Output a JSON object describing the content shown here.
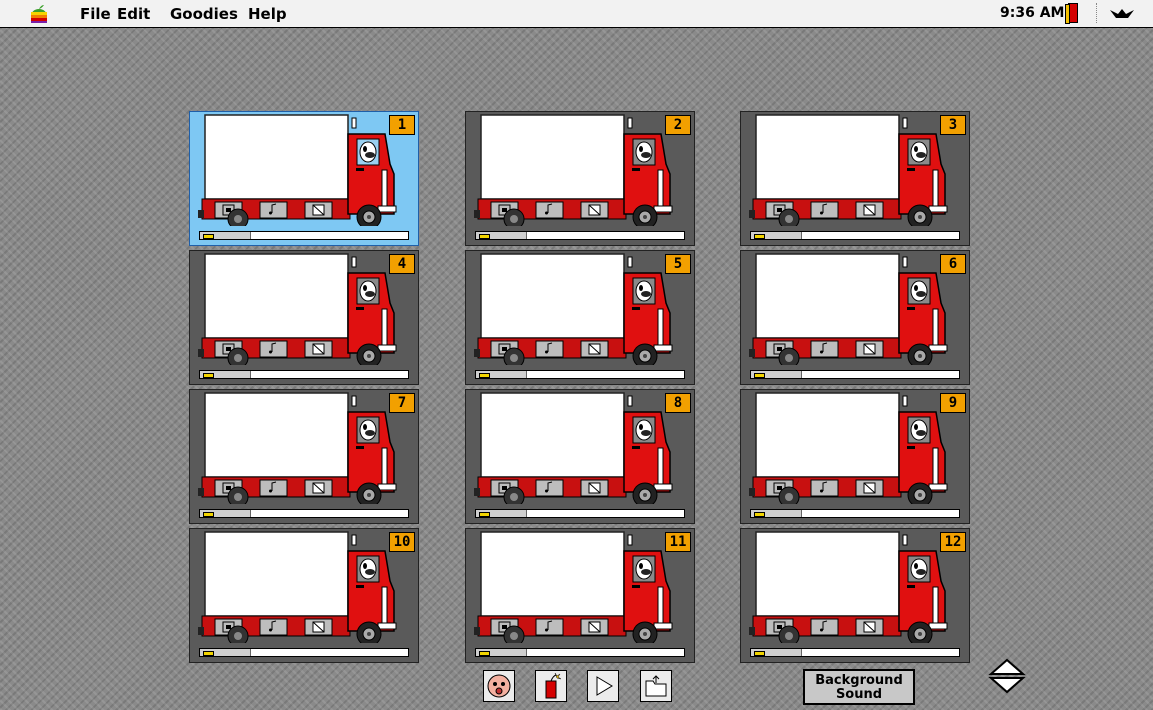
{
  "menubar": {
    "menus": [
      "File",
      "Edit",
      "Goodies",
      "Help"
    ],
    "clock": "9:36 AM"
  },
  "cards": [
    {
      "number": "1",
      "selected": true
    },
    {
      "number": "2",
      "selected": false
    },
    {
      "number": "3",
      "selected": false
    },
    {
      "number": "4",
      "selected": false
    },
    {
      "number": "5",
      "selected": false
    },
    {
      "number": "6",
      "selected": false
    },
    {
      "number": "7",
      "selected": false
    },
    {
      "number": "8",
      "selected": false
    },
    {
      "number": "9",
      "selected": false
    },
    {
      "number": "10",
      "selected": false
    },
    {
      "number": "11",
      "selected": false
    },
    {
      "number": "12",
      "selected": false
    }
  ],
  "toolbar": {
    "buttons": [
      "face-icon",
      "dynamite-icon",
      "play-icon",
      "folder-icon"
    ],
    "background_sound_label_line1": "Background",
    "background_sound_label_line2": "Sound"
  },
  "colors": {
    "truck_red": "#e01010",
    "selected_card": "#7ec8f3",
    "number_badge": "#f2a000",
    "card_background": "#5a5a5a"
  }
}
